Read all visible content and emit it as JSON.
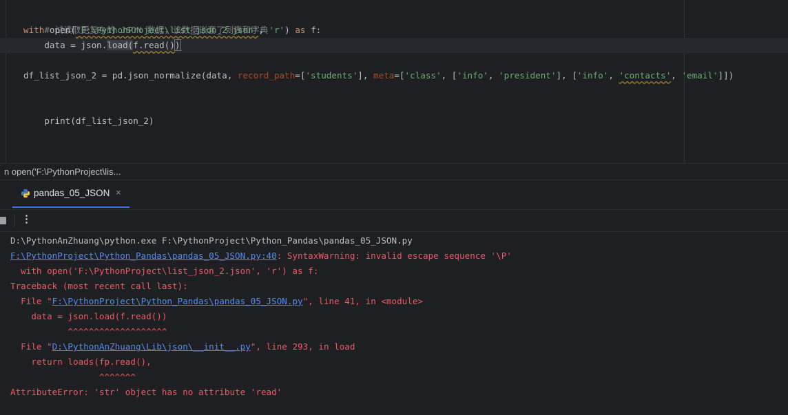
{
  "editor": {
    "line1_comment": "# 试读取更复杂的 JSON 数据，该数据嵌套了列表和字典",
    "line2": {
      "kw_with": "with",
      "open_fn": " open(",
      "path_str": "'F:\\PythonProject\\list_json_2.json'",
      "sep": ", ",
      "mode_str": "'r'",
      "close_paren": ") ",
      "kw_as": "as",
      "tail": " f:"
    },
    "line3": {
      "indent": "    data = json.",
      "load_call": "load(",
      "arg": "f.read()",
      "close": ")"
    },
    "line4": {
      "head": "df_list_json_2 = pd.json_normalize(data, ",
      "record_kw": "record_path",
      "eq1": "=[",
      "students": "'students'",
      "mid1": "], ",
      "meta_kw": "meta",
      "eq2": "=[",
      "class": "'class'",
      "c1": ", [",
      "info1": "'info'",
      "c2": ", ",
      "president": "'president'",
      "c3": "], [",
      "info2": "'info'",
      "c4": ", ",
      "contacts": "'contacts'",
      "c5": ", ",
      "email": "'email'",
      "tail": "]])"
    },
    "line5": "print(df_list_json_2)"
  },
  "breadcrumb": "n open('F:\\PythonProject\\lis...",
  "run_tab": {
    "label": "pandas_05_JSON",
    "close": "×"
  },
  "toolbar": {
    "more": "⋮"
  },
  "console": {
    "cmd": "D:\\PythonAnZhuang\\python.exe F:\\PythonProject\\Python_Pandas\\pandas_05_JSON.py",
    "warn_link": "F:\\PythonProject\\Python_Pandas\\pandas_05_JSON.py:40",
    "warn_text": ": SyntaxWarning: invalid escape sequence '\\P'",
    "warn_src": "  with open('F:\\PythonProject\\list_json_2.json', 'r') as f:",
    "traceback": "Traceback (most recent call last):",
    "file1_pre": "  File \"",
    "file1_link": "F:\\PythonProject\\Python_Pandas\\pandas_05_JSON.py",
    "file1_post": "\", line 41, in <module>",
    "code1": "    data = json.load(f.read())",
    "caret1": "           ^^^^^^^^^^^^^^^^^^^",
    "file2_pre": "  File \"",
    "file2_link": "D:\\PythonAnZhuang\\Lib\\json\\__init__.py",
    "file2_post": "\", line 293, in load",
    "code2": "    return loads(fp.read(),",
    "caret2": "                 ^^^^^^^",
    "error": "AttributeError: 'str' object has no attribute 'read'"
  }
}
